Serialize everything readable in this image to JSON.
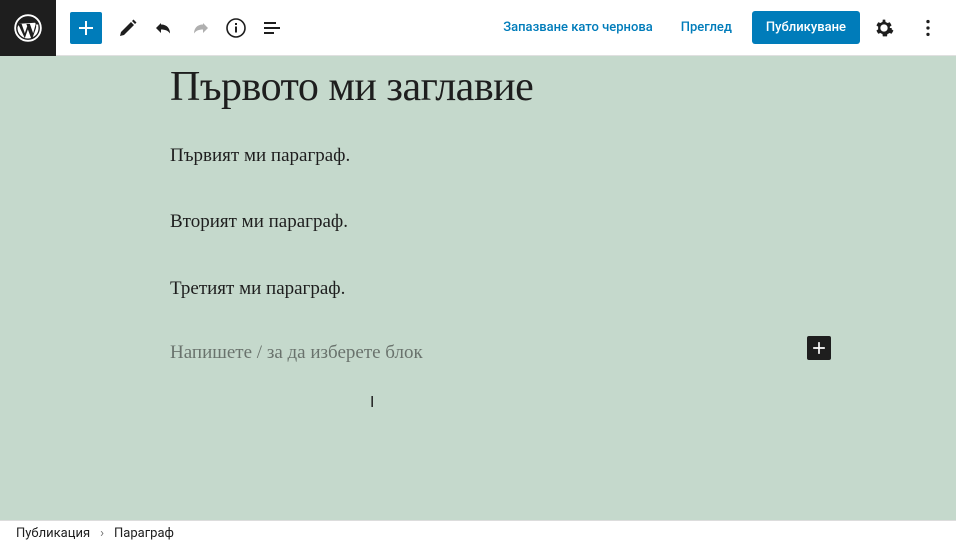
{
  "toolbar": {
    "save_draft": "Запазване като чернова",
    "preview": "Преглед",
    "publish": "Публикуване"
  },
  "post": {
    "title": "Първото ми заглавие",
    "paragraphs": [
      "Първият ми параграф.",
      "Вторият ми параграф.",
      "Третият ми параграф."
    ],
    "placeholder": "Напишете / за да изберете блок"
  },
  "breadcrumb": {
    "root": "Публикация",
    "current": "Параграф"
  },
  "colors": {
    "accent": "#007cba",
    "canvas_bg": "#c5d9cc"
  }
}
